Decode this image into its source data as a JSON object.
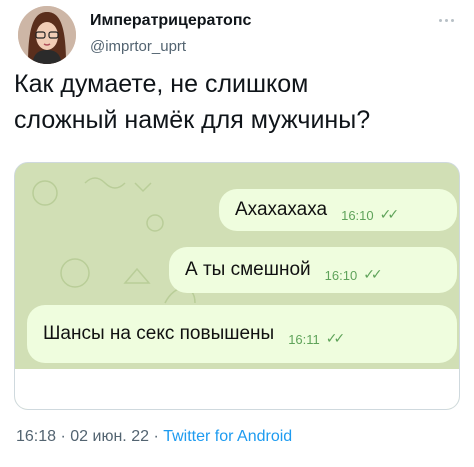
{
  "author": {
    "display_name": "Императрицератопс",
    "handle": "@imprtor_uprt"
  },
  "tweet": {
    "text": "Как думаете, не слишком\nсложный намёк для мужчины?"
  },
  "chat": {
    "messages": [
      {
        "text": "Ахахахаха",
        "time": "16:10",
        "status": "read-double-check"
      },
      {
        "text": "А ты смешной",
        "time": "16:10",
        "status": "read-double-check"
      },
      {
        "text": "Шансы на секс повышены",
        "time": "16:11",
        "status": "read-double-check"
      }
    ],
    "bubble_color": "#effdde",
    "background_color": "#d1dfb5",
    "accent_color": "#5fa35a"
  },
  "meta": {
    "time": "16:18",
    "separator": "·",
    "date": "02 июн. 22",
    "source": "Twitter for Android"
  },
  "icons": {
    "more": "more-dots-icon",
    "read_status": "double-check-icon"
  }
}
